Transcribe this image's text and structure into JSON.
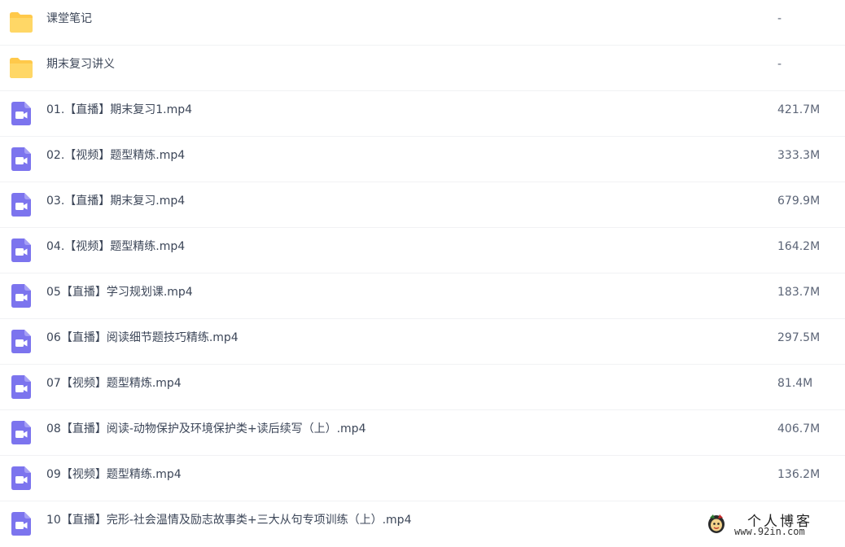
{
  "files": [
    {
      "type": "folder",
      "icon": "folder-icon",
      "name": "课堂笔记",
      "size": "-"
    },
    {
      "type": "folder",
      "icon": "folder-icon",
      "name": "期末复习讲义",
      "size": "-"
    },
    {
      "type": "video",
      "icon": "video-file-icon",
      "name": "01.【直播】期末复习1.mp4",
      "size": "421.7M"
    },
    {
      "type": "video",
      "icon": "video-file-icon",
      "name": "02.【视频】题型精炼.mp4",
      "size": "333.3M"
    },
    {
      "type": "video",
      "icon": "video-file-icon",
      "name": "03.【直播】期末复习.mp4",
      "size": "679.9M"
    },
    {
      "type": "video",
      "icon": "video-file-icon",
      "name": "04.【视频】题型精练.mp4",
      "size": "164.2M"
    },
    {
      "type": "video",
      "icon": "video-file-icon",
      "name": "05【直播】学习规划课.mp4",
      "size": "183.7M"
    },
    {
      "type": "video",
      "icon": "video-file-icon",
      "name": "06【直播】阅读细节题技巧精练.mp4",
      "size": "297.5M"
    },
    {
      "type": "video",
      "icon": "video-file-icon",
      "name": "07【视频】题型精炼.mp4",
      "size": "81.4M"
    },
    {
      "type": "video",
      "icon": "video-file-icon",
      "name": "08【直播】阅读-动物保护及环境保护类+读后续写（上）.mp4",
      "size": "406.7M"
    },
    {
      "type": "video",
      "icon": "video-file-icon",
      "name": "09【视频】题型精练.mp4",
      "size": "136.2M"
    },
    {
      "type": "video",
      "icon": "video-file-icon",
      "name": "10【直播】完形-社会温情及励志故事类+三大从句专项训练（上）.mp4",
      "size": ""
    }
  ],
  "watermark": {
    "title": "个人博客",
    "url": "www.92in.com"
  },
  "colors": {
    "folder": "#ffc94a",
    "video": "#7c74ee",
    "divider": "#f1f2f4",
    "text": "#3c4658"
  }
}
